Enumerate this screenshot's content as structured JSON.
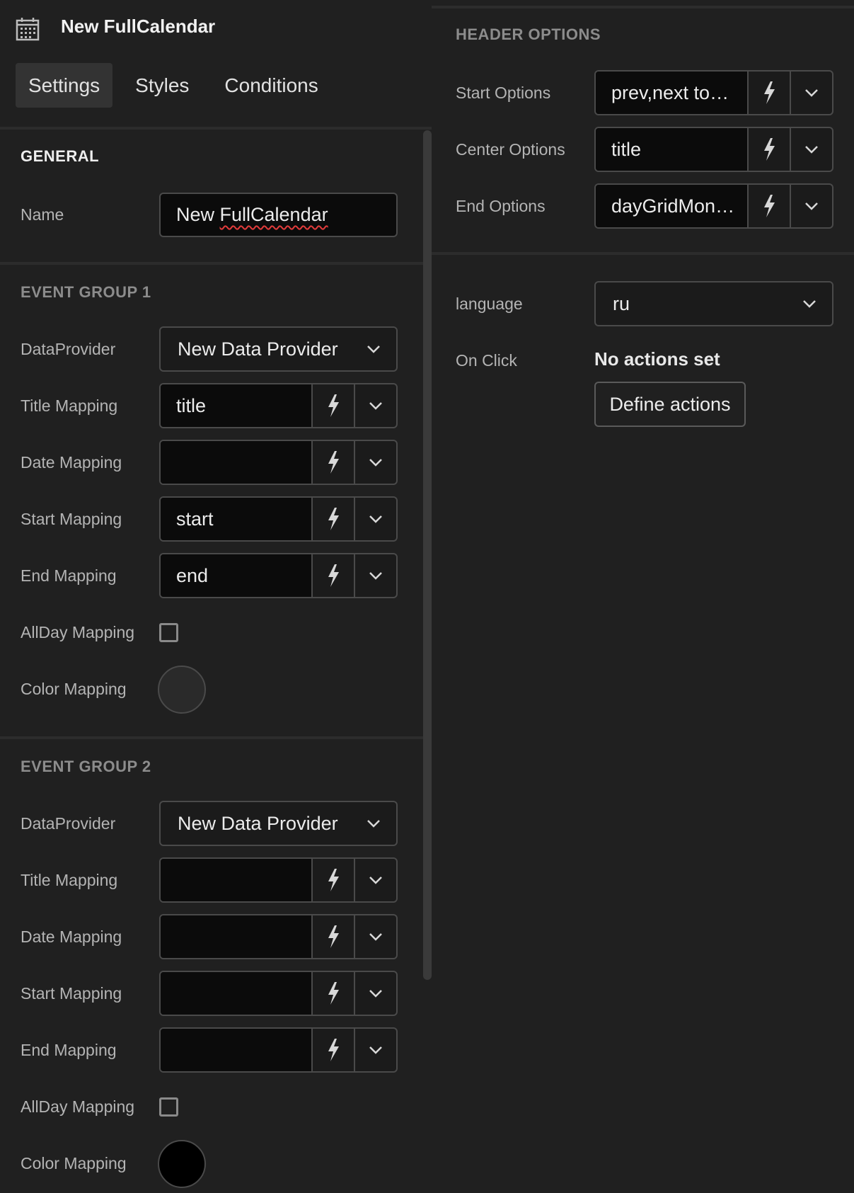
{
  "component": {
    "title": "New FullCalendar",
    "icon": "calendar-icon"
  },
  "tabs": [
    {
      "label": "Settings",
      "active": true
    },
    {
      "label": "Styles",
      "active": false
    },
    {
      "label": "Conditions",
      "active": false
    }
  ],
  "general": {
    "heading": "GENERAL",
    "name_label": "Name",
    "name_value_prefix": "New ",
    "name_value_misspelled": "FullCalendar"
  },
  "event_group_1": {
    "heading": "EVENT GROUP 1",
    "dataprovider_label": "DataProvider",
    "dataprovider_value": "New Data Provider",
    "title_label": "Title Mapping",
    "title_value": "title",
    "date_label": "Date Mapping",
    "date_value": "",
    "start_label": "Start Mapping",
    "start_value": "start",
    "end_label": "End Mapping",
    "end_value": "end",
    "allday_label": "AllDay Mapping",
    "allday_checked": false,
    "color_label": "Color Mapping",
    "color_value": "#2a2a2a"
  },
  "event_group_2": {
    "heading": "EVENT GROUP 2",
    "dataprovider_label": "DataProvider",
    "dataprovider_value": "New Data Provider",
    "title_label": "Title Mapping",
    "title_value": "",
    "date_label": "Date Mapping",
    "date_value": "",
    "start_label": "Start Mapping",
    "start_value": "",
    "end_label": "End Mapping",
    "end_value": "",
    "allday_label": "AllDay Mapping",
    "allday_checked": false,
    "color_label": "Color Mapping",
    "color_value": "#000000"
  },
  "header_options": {
    "heading": "HEADER OPTIONS",
    "start_label": "Start Options",
    "start_value": "prev,next to…",
    "center_label": "Center Options",
    "center_value": "title",
    "end_label": "End Options",
    "end_value": "dayGridMon…"
  },
  "misc": {
    "language_label": "language",
    "language_value": "ru",
    "onclick_label": "On Click",
    "onclick_status": "No actions set",
    "define_actions_label": "Define actions"
  },
  "icons": {
    "bolt": "lightning-bolt-icon",
    "chevron": "chevron-down-icon"
  },
  "colors": {
    "background": "#202020",
    "input_background": "#0b0b0b",
    "border": "#4a4a4a",
    "tab_active": "#333333"
  }
}
